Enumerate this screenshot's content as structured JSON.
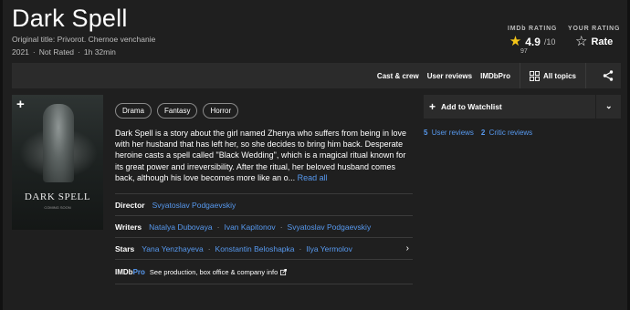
{
  "movie": {
    "title": "Dark Spell",
    "original_title": "Original title: Privorot. Chernoe venchanie",
    "year": "2021",
    "rating_cert": "Not Rated",
    "runtime": "1h 32min"
  },
  "ratings": {
    "imdb_label": "IMDb RATING",
    "imdb_score": "4.9",
    "imdb_out_of": "/10",
    "imdb_votes": "97",
    "your_label": "YOUR RATING",
    "rate_label": "Rate"
  },
  "navbar": {
    "links": [
      "Cast & crew",
      "User reviews",
      "IMDbPro"
    ],
    "all_topics": "All topics"
  },
  "poster": {
    "title": "DARK SPELL",
    "subtitle": "COMING SOON"
  },
  "genres": [
    "Drama",
    "Fantasy",
    "Horror"
  ],
  "plot": {
    "text": "Dark Spell is a story about the girl named Zhenya who suffers from being in love with her husband that has left her, so she decides to bring him back. Desperate heroine casts a spell called \"Black Wedding\", which is a magical ritual known for its great power and irreversibility. After the ritual, her beloved husband comes back, although his love becomes more like an o...",
    "read_all": "Read all"
  },
  "credits": {
    "director_label": "Director",
    "directors": [
      "Svyatoslav Podgaevskiy"
    ],
    "writers_label": "Writers",
    "writers": [
      "Natalya Dubovaya",
      "Ivan Kapitonov",
      "Svyatoslav Podgaevskiy"
    ],
    "stars_label": "Stars",
    "stars": [
      "Yana Yenzhayeva",
      "Konstantin Beloshapka",
      "Ilya Yermolov"
    ]
  },
  "imdbpro": {
    "logo_a": "IMDb",
    "logo_b": "Pro",
    "text": "See production, box office & company info"
  },
  "watchlist": {
    "label": "Add to Watchlist"
  },
  "reviews": {
    "user_count": "5",
    "user_label": "User reviews",
    "critic_count": "2",
    "critic_label": "Critic reviews"
  },
  "colors": {
    "background": "#1f1f1f",
    "panel": "#2b2b2b",
    "link": "#5799ef",
    "star": "#f5c518"
  }
}
